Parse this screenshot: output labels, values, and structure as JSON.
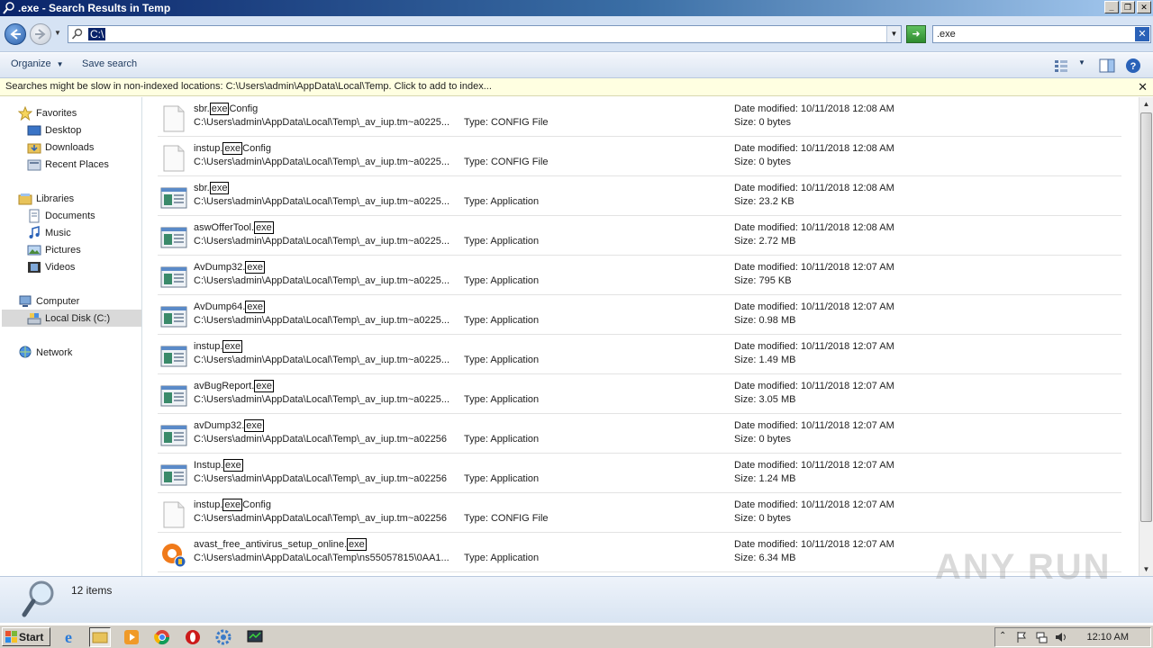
{
  "window": {
    "title": ".exe - Search Results in Temp"
  },
  "address": {
    "value": "C:\\"
  },
  "search": {
    "value": ".exe"
  },
  "toolbar": {
    "organize": "Organize",
    "save_search": "Save search"
  },
  "infobar": {
    "message": "Searches might be slow in non-indexed locations: C:\\Users\\admin\\AppData\\Local\\Temp. Click to add to index..."
  },
  "nav": {
    "favorites": "Favorites",
    "desktop": "Desktop",
    "downloads": "Downloads",
    "recent": "Recent Places",
    "libraries": "Libraries",
    "documents": "Documents",
    "music": "Music",
    "pictures": "Pictures",
    "videos": "Videos",
    "computer": "Computer",
    "localdisk": "Local Disk (C:)",
    "network": "Network"
  },
  "results": [
    {
      "pre": "sbr.",
      "hl": "exe",
      "post": "Config",
      "path": "C:\\Users\\admin\\AppData\\Local\\Temp\\_av_iup.tm~a0225...",
      "type": "Type: CONFIG File",
      "date": "Date modified: 10/11/2018 12:08 AM",
      "size": "Size: 0 bytes",
      "icon": "config"
    },
    {
      "pre": "instup.",
      "hl": "exe",
      "post": "Config",
      "path": "C:\\Users\\admin\\AppData\\Local\\Temp\\_av_iup.tm~a0225...",
      "type": "Type: CONFIG File",
      "date": "Date modified: 10/11/2018 12:08 AM",
      "size": "Size: 0 bytes",
      "icon": "config"
    },
    {
      "pre": "sbr.",
      "hl": "exe",
      "post": "",
      "path": "C:\\Users\\admin\\AppData\\Local\\Temp\\_av_iup.tm~a0225...",
      "type": "Type: Application",
      "date": "Date modified: 10/11/2018 12:08 AM",
      "size": "Size: 23.2 KB",
      "icon": "app"
    },
    {
      "pre": "aswOfferTool.",
      "hl": "exe",
      "post": "",
      "path": "C:\\Users\\admin\\AppData\\Local\\Temp\\_av_iup.tm~a0225...",
      "type": "Type: Application",
      "date": "Date modified: 10/11/2018 12:08 AM",
      "size": "Size: 2.72 MB",
      "icon": "app"
    },
    {
      "pre": "AvDump32.",
      "hl": "exe",
      "post": "",
      "path": "C:\\Users\\admin\\AppData\\Local\\Temp\\_av_iup.tm~a0225...",
      "type": "Type: Application",
      "date": "Date modified: 10/11/2018 12:07 AM",
      "size": "Size: 795 KB",
      "icon": "app"
    },
    {
      "pre": "AvDump64.",
      "hl": "exe",
      "post": "",
      "path": "C:\\Users\\admin\\AppData\\Local\\Temp\\_av_iup.tm~a0225...",
      "type": "Type: Application",
      "date": "Date modified: 10/11/2018 12:07 AM",
      "size": "Size: 0.98 MB",
      "icon": "app"
    },
    {
      "pre": "instup.",
      "hl": "exe",
      "post": "",
      "path": "C:\\Users\\admin\\AppData\\Local\\Temp\\_av_iup.tm~a0225...",
      "type": "Type: Application",
      "date": "Date modified: 10/11/2018 12:07 AM",
      "size": "Size: 1.49 MB",
      "icon": "app"
    },
    {
      "pre": "avBugReport.",
      "hl": "exe",
      "post": "",
      "path": "C:\\Users\\admin\\AppData\\Local\\Temp\\_av_iup.tm~a0225...",
      "type": "Type: Application",
      "date": "Date modified: 10/11/2018 12:07 AM",
      "size": "Size: 3.05 MB",
      "icon": "app"
    },
    {
      "pre": "avDump32.",
      "hl": "exe",
      "post": "",
      "path": "C:\\Users\\admin\\AppData\\Local\\Temp\\_av_iup.tm~a02256",
      "type": "Type: Application",
      "date": "Date modified: 10/11/2018 12:07 AM",
      "size": "Size: 0 bytes",
      "icon": "app"
    },
    {
      "pre": "Instup.",
      "hl": "exe",
      "post": "",
      "path": "C:\\Users\\admin\\AppData\\Local\\Temp\\_av_iup.tm~a02256",
      "type": "Type: Application",
      "date": "Date modified: 10/11/2018 12:07 AM",
      "size": "Size: 1.24 MB",
      "icon": "app"
    },
    {
      "pre": "instup.",
      "hl": "exe",
      "post": "Config",
      "path": "C:\\Users\\admin\\AppData\\Local\\Temp\\_av_iup.tm~a02256",
      "type": "Type: CONFIG File",
      "date": "Date modified: 10/11/2018 12:07 AM",
      "size": "Size: 0 bytes",
      "icon": "config"
    },
    {
      "pre": "avast_free_antivirus_setup_online.",
      "hl": "exe",
      "post": "",
      "path": "C:\\Users\\admin\\AppData\\Local\\Temp\\ns55057815\\0AA1...",
      "type": "Type: Application",
      "date": "Date modified: 10/11/2018 12:07 AM",
      "size": "Size: 6.34 MB",
      "icon": "avast"
    }
  ],
  "details": {
    "count": "12 items"
  },
  "watermark": "ANY RUN",
  "taskbar": {
    "start": "Start",
    "time": "12:10 AM"
  }
}
